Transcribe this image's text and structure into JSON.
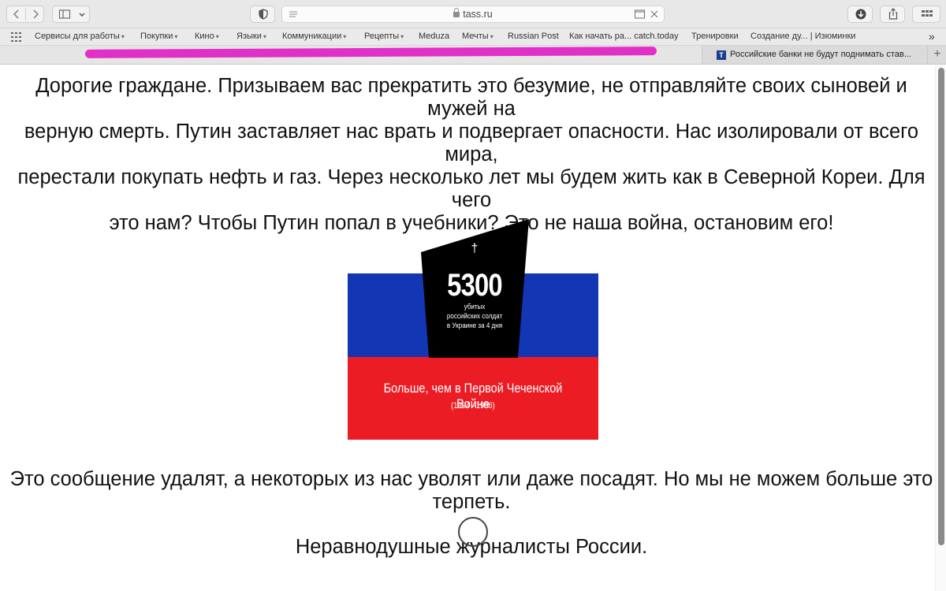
{
  "browser": {
    "url": "tass.ru",
    "bookmarks": [
      {
        "label": "Сервисы для работы",
        "menu": true
      },
      {
        "label": "Покупки",
        "menu": true
      },
      {
        "label": "Кино",
        "menu": true
      },
      {
        "label": "Языки",
        "menu": true
      },
      {
        "label": "Коммуникации",
        "menu": true
      },
      {
        "label": "Рецепты",
        "menu": true
      },
      {
        "label": "Meduza",
        "menu": false
      },
      {
        "label": "Мечты",
        "menu": true
      },
      {
        "label": "Russian Post",
        "menu": false
      },
      {
        "label": "Как начать ра... catch.today",
        "menu": false
      },
      {
        "label": "Тренировки",
        "menu": false
      },
      {
        "label": "Создание ду... | Изюминки",
        "menu": false
      }
    ],
    "overflow": "»",
    "tab2": {
      "favicon": "T",
      "title": "Российские банки не будут поднимать став..."
    },
    "new_tab": "+",
    "colors": {
      "redaction": "#e030c8"
    }
  },
  "page": {
    "paragraph1": [
      "Дорогие граждане. Призываем вас прекратить это безумие, не отправляйте своих сыновей и мужей на",
      "верную смерть. Путин заставляет нас врать и подвергает опасности. Нас изолировали от всего мира,",
      "перестали покупать нефть и газ. Через несколько лет мы будем жить как в Северной Кореи. Для чего",
      "это нам? Чтобы Путин попал в учебники? Это не наша война, остановим его!"
    ],
    "graphic": {
      "cross": "†",
      "number": "5300",
      "caption_lines": [
        "убитых",
        "российских солдат",
        "в Украине за 4 дня"
      ],
      "headline": "Больше, чем в Первой Чеченской Войне",
      "years": "(1994 –1996)",
      "colors": {
        "blue": "#1236b4",
        "red": "#ec1c24",
        "stone": "#000000"
      }
    },
    "paragraph2": [
      "Это сообщение удалят, а некоторых из нас уволят или даже посадят. Но мы не можем больше это",
      "терпеть."
    ],
    "signature": "Неравнодушные журналисты России."
  }
}
